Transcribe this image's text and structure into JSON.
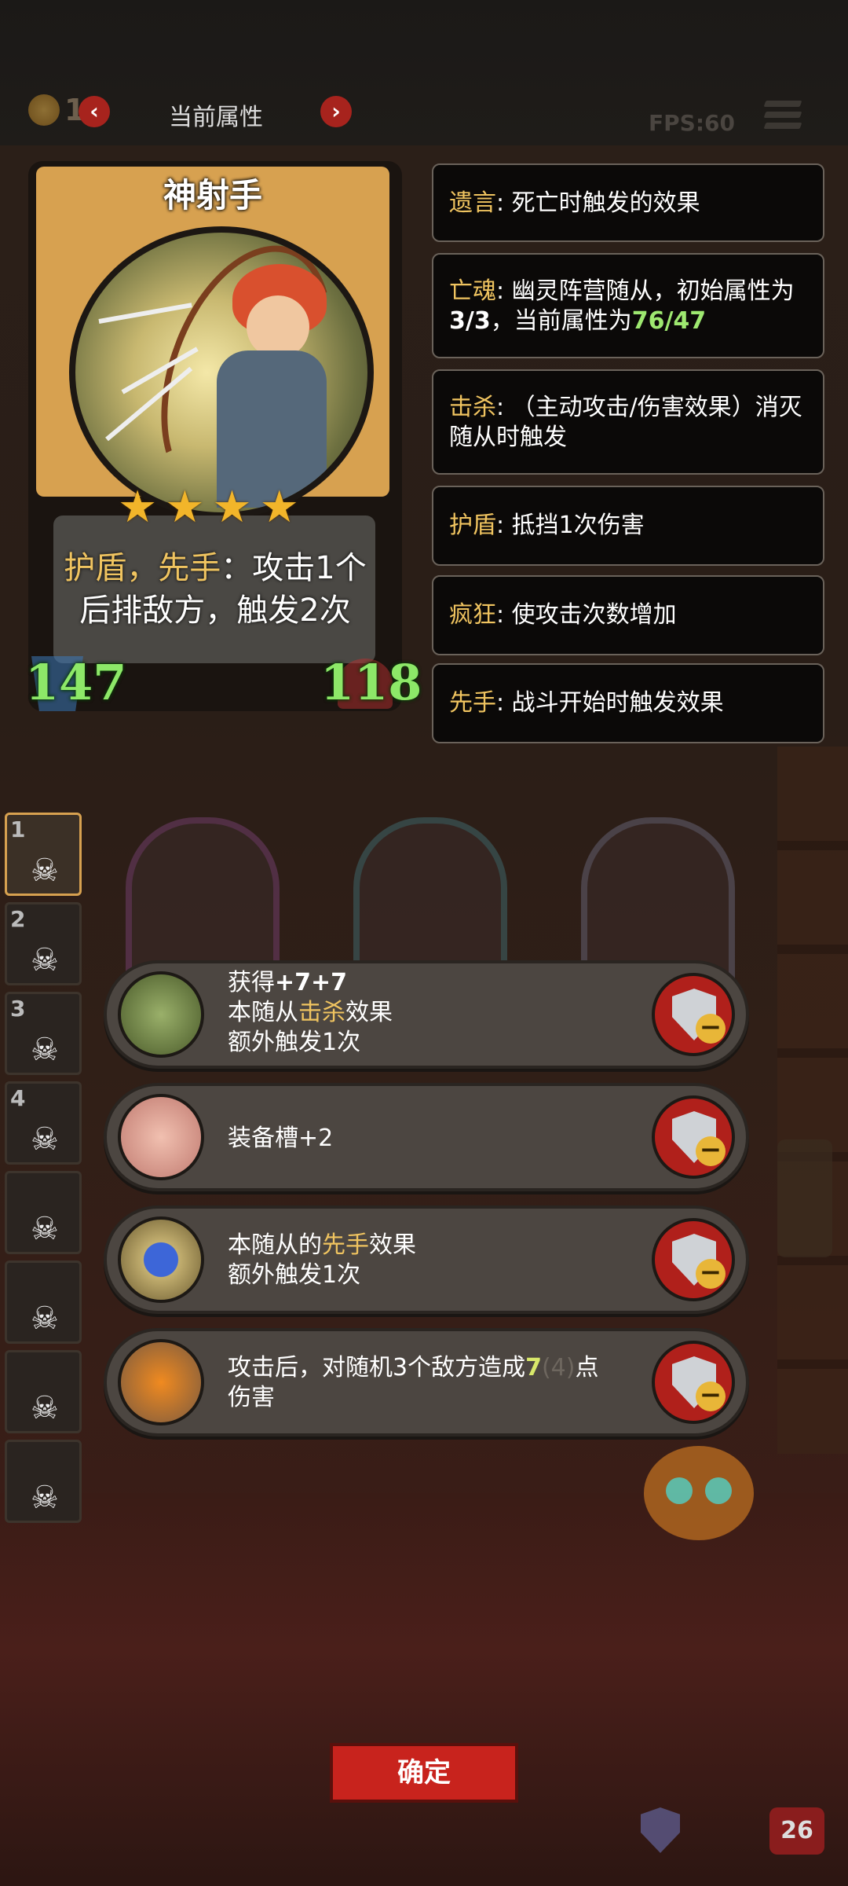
{
  "topbar": {
    "coin_value": "16",
    "title": "当前属性",
    "prev_arrow": "‹",
    "next_arrow": "›",
    "fps": "FPS:60"
  },
  "card": {
    "name": "神射手",
    "stars": 4,
    "desc_kw1": "护盾",
    "desc_sep": "，",
    "desc_kw2": "先手",
    "desc_line1_rest": "：攻击1个",
    "desc_line2": "后排敌方，触发2次",
    "attack": "147",
    "health": "118"
  },
  "keywords": [
    {
      "name": "遗言",
      "text": ": 死亡时触发的效果"
    },
    {
      "name": "亡魂",
      "text": ": 幽灵阵营随从，初始属性为",
      "line2_a": "3/3",
      "line2_b": "，当前属性为",
      "line2_c": "76/47"
    },
    {
      "name": "击杀",
      "text": ": （主动攻击/伤害效果）消灭",
      "line2": "随从时触发"
    },
    {
      "name": "护盾",
      "text": ": 抵挡1次伤害"
    },
    {
      "name": "疯狂",
      "text": ": 使攻击次数增加"
    },
    {
      "name": "先手",
      "text": ": 战斗开始时触发效果"
    }
  ],
  "side_slots": [
    "1",
    "2",
    "3",
    "4",
    "",
    "",
    "",
    ""
  ],
  "equipment": [
    {
      "line1a": "获得",
      "line1b": "+7+7",
      "line2a": "本随从",
      "line2kw": "击杀",
      "line2b": "效果",
      "line3": "额外触发1次"
    },
    {
      "line1": "装备槽+2"
    },
    {
      "line1a": "本随从的",
      "line1kw": "先手",
      "line1b": "效果",
      "line2": "额外触发1次"
    },
    {
      "line1a": "攻击后，对随机3个敌方造成",
      "line1num": "7",
      "line1dim": "(4)",
      "line1b": "点",
      "line2": "伤害"
    }
  ],
  "confirm_label": "确定",
  "bottom_count": "26",
  "colors": {
    "keyword": "#f0c460",
    "stat_green": "#8de868",
    "button_red": "#c8231d"
  }
}
